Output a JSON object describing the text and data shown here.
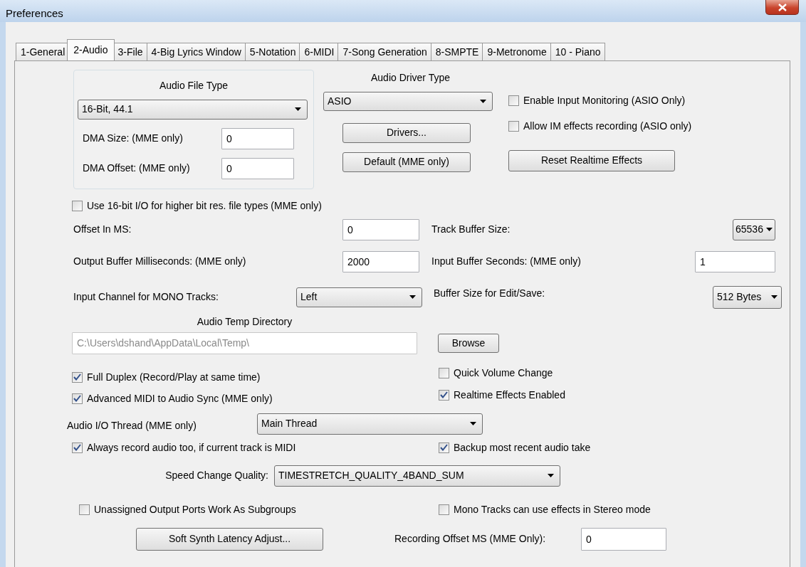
{
  "window": {
    "title": "Preferences"
  },
  "tabs": [
    {
      "label": "1-General",
      "selected": false
    },
    {
      "label": "2-Audio",
      "selected": true
    },
    {
      "label": "3-File",
      "selected": false
    },
    {
      "label": "4-Big Lyrics Window",
      "selected": false
    },
    {
      "label": "5-Notation",
      "selected": false
    },
    {
      "label": "6-MIDI",
      "selected": false
    },
    {
      "label": "7-Song Generation",
      "selected": false
    },
    {
      "label": "8-SMPTE",
      "selected": false
    },
    {
      "label": "9-Metronome",
      "selected": false
    },
    {
      "label": "10 - Piano",
      "selected": false
    }
  ],
  "audio_file_type": {
    "label": "Audio File Type",
    "value": "16-Bit, 44.1"
  },
  "dma_size": {
    "label": "DMA Size: (MME only)",
    "value": "0"
  },
  "dma_offset": {
    "label": "DMA Offset: (MME only)",
    "value": "0"
  },
  "audio_driver_type": {
    "label": "Audio Driver Type",
    "value": "ASIO"
  },
  "driver_buttons": [
    "Drivers...",
    "Default (MME only)"
  ],
  "asio_options": [
    {
      "label": "Enable Input Monitoring (ASIO Only)",
      "checked": false
    },
    {
      "label": "Allow IM effects recording (ASIO only)",
      "checked": false
    }
  ],
  "reset_button": "Reset Realtime Effects",
  "use_16bit_io": {
    "label": "Use 16-bit I/O for higher bit res. file types (MME only)",
    "checked": false
  },
  "offset_ms": {
    "label": "Offset In MS:",
    "value": "0"
  },
  "track_buffer_size": {
    "label": "Track Buffer Size:",
    "value": "65536"
  },
  "output_buffer": {
    "label": "Output Buffer Milliseconds: (MME only)",
    "value": "2000"
  },
  "input_buffer_seconds": {
    "label": "Input Buffer Seconds: (MME only)",
    "value": "1"
  },
  "input_channel": {
    "label": "Input Channel for MONO Tracks:",
    "value": "Left"
  },
  "edit_buffer_size": {
    "label": "Buffer Size for Edit/Save:",
    "value": "512 Bytes"
  },
  "temp_directory": {
    "label": "Audio Temp Directory",
    "value": "C:\\Users\\dshand\\AppData\\Local\\Temp\\",
    "disabled": true,
    "button": "Browse"
  },
  "options_left": [
    {
      "label": "Full Duplex (Record/Play at same time)",
      "checked": true
    },
    {
      "label": "Advanced MIDI to Audio Sync (MME only)",
      "checked": true
    }
  ],
  "options_right": [
    {
      "label": "Quick Volume Change",
      "checked": false
    },
    {
      "label": "Realtime Effects Enabled",
      "checked": true
    }
  ],
  "io_thread": {
    "label": "Audio I/O Thread (MME only)",
    "value": "Main Thread"
  },
  "record_options": [
    {
      "label": "Always record audio too, if current track is MIDI",
      "checked": true
    },
    {
      "label": "Backup most recent audio take",
      "checked": true
    }
  ],
  "speed_change_quality": {
    "label": "Speed Change Quality:",
    "value": "TIMESTRETCH_QUALITY_4BAND_SUM"
  },
  "routing_options": [
    {
      "label": "Unassigned Output Ports Work As Subgroups",
      "checked": false
    },
    {
      "label": "Mono Tracks can use effects in Stereo mode",
      "checked": false
    }
  ],
  "soft_synth_button": "Soft Synth Latency Adjust...",
  "recording_offset": {
    "label": "Recording Offset MS (MME Only):",
    "value": "0"
  }
}
